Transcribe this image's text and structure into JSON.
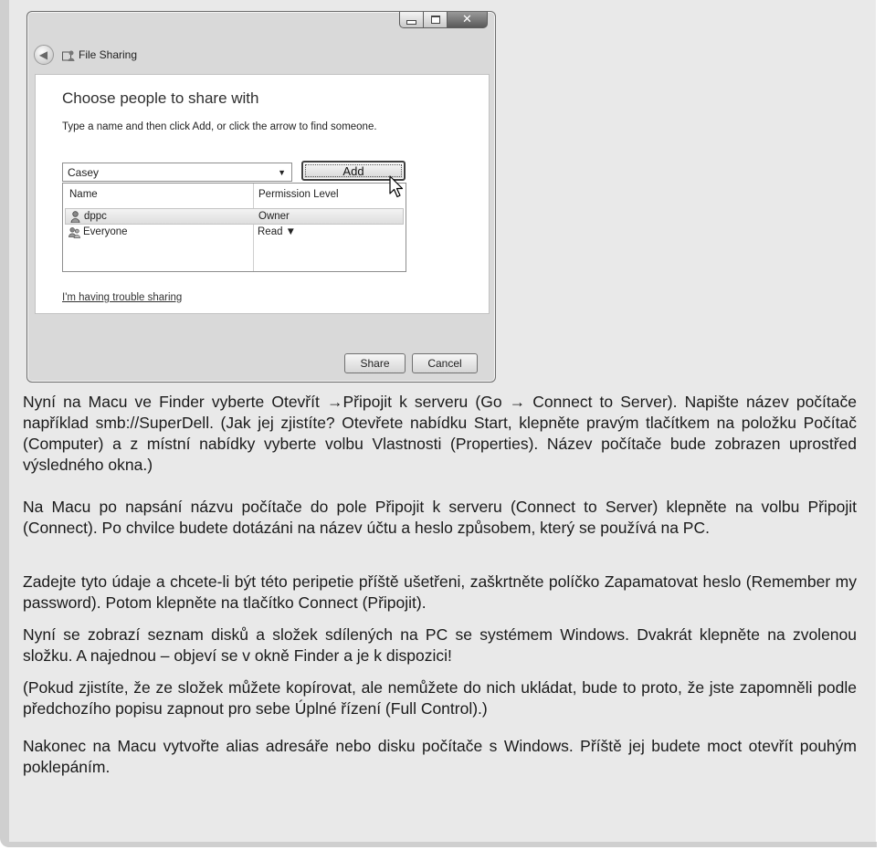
{
  "dialog": {
    "window_title": "File Sharing",
    "heading": "Choose people to share with",
    "instruction": "Type a name and then click Add, or click the arrow to find someone.",
    "name_input_value": "Casey",
    "add_button": "Add",
    "columns": [
      "Name",
      "Permission Level"
    ],
    "rows": [
      {
        "name": "dppc",
        "permission": "Owner",
        "icon": "user-icon",
        "selected": true
      },
      {
        "name": "Everyone",
        "permission": "Read ▼",
        "icon": "group-icon",
        "selected": false
      }
    ],
    "trouble_link": "I'm having trouble sharing",
    "share_button": "Share",
    "cancel_button": "Cancel"
  },
  "paragraphs": [
    "Nyní na Macu ve Finder vyberte Otevřít →Připojit k serveru (Go → Connect to Server). Napište název počítače například smb://SuperDell. (Jak jej zjistíte? Otevřete nabídku Start, klepněte pravým tlačítkem na položku Počítač (Computer) a z místní nabídky vyberte volbu Vlastnosti (Properties). Název počítače bude zobrazen uprostřed výsledného okna.)",
    "Na Macu po napsání názvu počítače do pole Připojit k serveru (Connect to Server) klepněte na volbu Připojit (Connect). Po chvilce budete dotázáni na název účtu a heslo způsobem, který se používá na PC.",
    "Zadejte tyto údaje a chcete-li být této peripetie příště ušetřeni, zaškrtněte políčko Zapamatovat heslo (Remember my password). Potom klepněte na tlačítko Connect (Připojit).",
    "Nyní se zobrazí seznam disků a složek sdílených na PC se systémem Windows. Dvakrát klepněte na zvolenou složku. A najednou – objeví se v okně Finder a je k dispozici!",
    "(Pokud zjistíte, že ze složek můžete kopírovat, ale nemůžete do nich ukládat, bude to proto, že jste zapomněli podle předchozího popisu zapnout pro sebe Úplné řízení (Full Control).)",
    "Nakonec na Macu vytvořte alias adresáře nebo disku počítače s Windows. Příště jej budete moct otevřít pouhým poklepáním."
  ],
  "colors": {
    "page_background": "#e9e9e9",
    "frame": "#cfcfcf",
    "dialog_chrome": "#d9d9d9",
    "text": "#1a1a1a"
  }
}
